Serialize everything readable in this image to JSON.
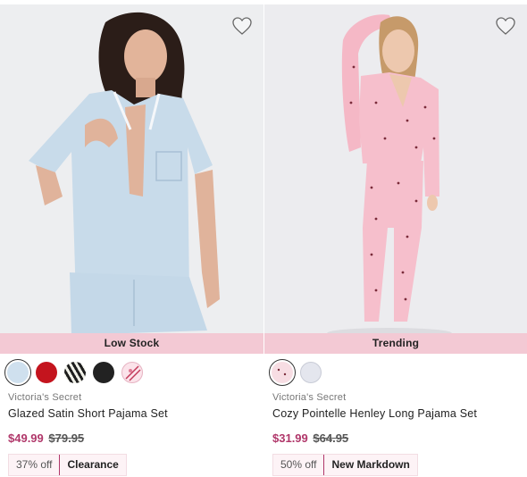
{
  "products": [
    {
      "badge": "Low Stock",
      "brand": "Victoria's Secret",
      "name": "Glazed Satin Short Pajama Set",
      "sale_price": "$49.99",
      "original_price": "$79.95",
      "discount": "37% off",
      "tag": "Clearance",
      "swatch_colors": [
        "#cfe0ee",
        "#c4141e",
        "striped-black-white",
        "#222222",
        "floral-pink"
      ],
      "favorite_icon": "heart-outline-icon"
    },
    {
      "badge": "Trending",
      "brand": "Victoria's Secret",
      "name": "Cozy Pointelle Henley Long Pajama Set",
      "sale_price": "$31.99",
      "original_price": "$64.95",
      "discount": "50% off",
      "tag": "New Markdown",
      "swatch_colors": [
        "#f7dde3",
        "#e4e6ee"
      ],
      "favorite_icon": "heart-outline-icon"
    }
  ],
  "colors": {
    "badge_bg": "#f3c9d4",
    "sale_price": "#b0376a",
    "tag_bg": "#fdf3f6"
  }
}
